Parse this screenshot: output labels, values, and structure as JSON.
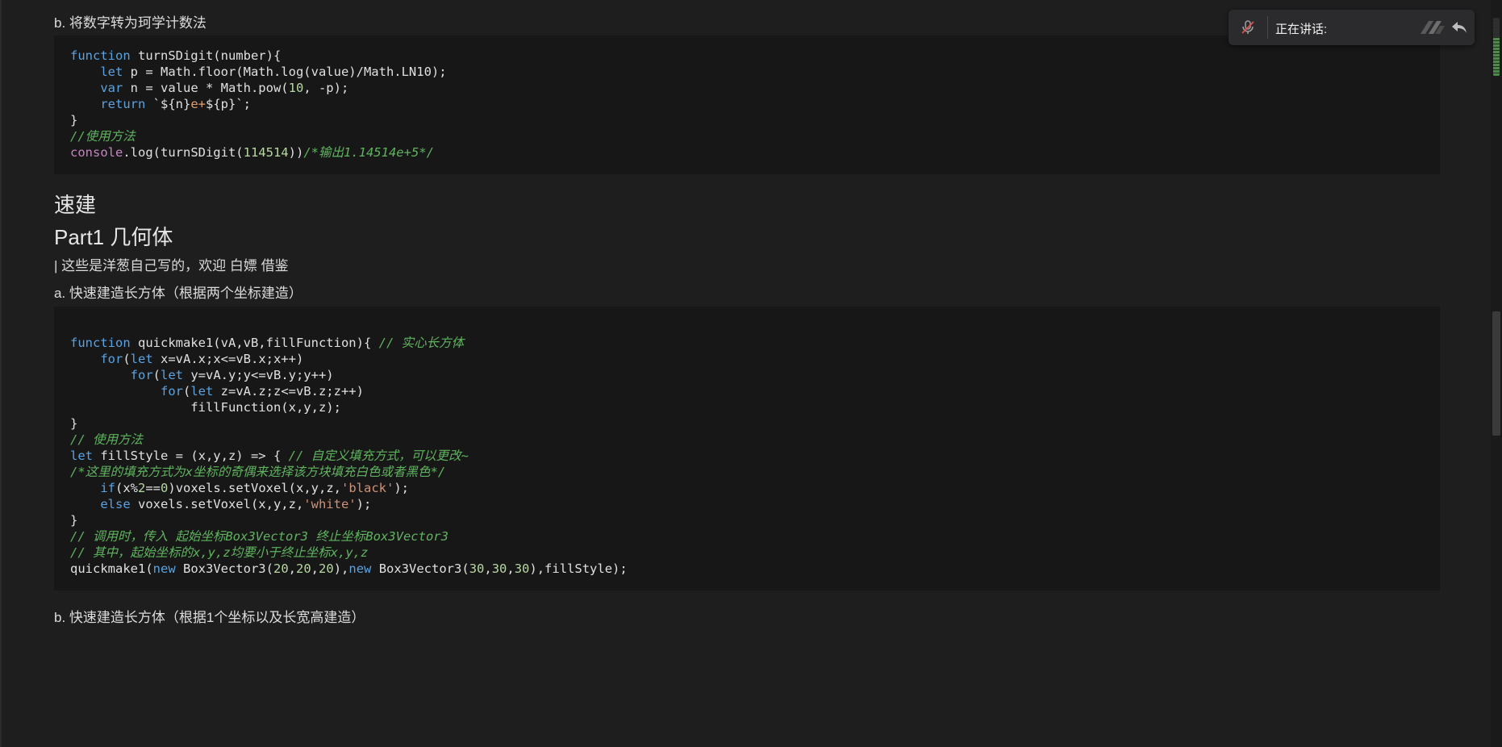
{
  "section_b_digit": {
    "heading": "b. 将数字转为珂学计数法",
    "code": [
      [
        [
          "kw",
          "function"
        ],
        [
          "",
          " turnSDigit(number){"
        ]
      ],
      [
        [
          "",
          "    "
        ],
        [
          "kw",
          "let"
        ],
        [
          "",
          " p = Math.floor(Math.log(value)/Math.LN10);"
        ]
      ],
      [
        [
          "",
          "    "
        ],
        [
          "kw",
          "var"
        ],
        [
          "",
          " n = value * Math.pow("
        ],
        [
          "num",
          "10"
        ],
        [
          "",
          ", -p);"
        ]
      ],
      [
        [
          "",
          "    "
        ],
        [
          "kw",
          "return"
        ],
        [
          "",
          " `${n}"
        ],
        [
          "tpl",
          "e+"
        ],
        [
          "",
          "${p}`;"
        ]
      ],
      [
        [
          "",
          "}"
        ]
      ],
      [
        [
          "cm",
          "//使用方法"
        ]
      ],
      [
        [
          "obj",
          "console"
        ],
        [
          "",
          ".log(turnSDigit("
        ],
        [
          "num",
          "114514"
        ],
        [
          "",
          "))"
        ],
        [
          "cm",
          "/*输出1.14514e+5*/"
        ]
      ]
    ]
  },
  "title_sujian": "速建",
  "title_part1": "Part1 几何体",
  "quote": "| 这些是洋葱自己写的，欢迎 白嫖 借鉴",
  "section_a": {
    "heading": "a. 快速建造长方体（根据两个坐标建造）",
    "code": [
      [
        [
          "kw",
          "function"
        ],
        [
          "",
          " quickmake1(vA,vB,fillFunction){ "
        ],
        [
          "cm",
          "// 实心长方体"
        ]
      ],
      [
        [
          "",
          "    "
        ],
        [
          "kw",
          "for"
        ],
        [
          "",
          "("
        ],
        [
          "kw",
          "let"
        ],
        [
          "",
          " x=vA.x;x<=vB.x;x++)"
        ]
      ],
      [
        [
          "",
          "        "
        ],
        [
          "kw",
          "for"
        ],
        [
          "",
          "("
        ],
        [
          "kw",
          "let"
        ],
        [
          "",
          " y=vA.y;y<=vB.y;y++)"
        ]
      ],
      [
        [
          "",
          "            "
        ],
        [
          "kw",
          "for"
        ],
        [
          "",
          "("
        ],
        [
          "kw",
          "let"
        ],
        [
          "",
          " z=vA.z;z<=vB.z;z++)"
        ]
      ],
      [
        [
          "",
          "                fillFunction(x,y,z);"
        ]
      ],
      [
        [
          "",
          "}"
        ]
      ],
      [
        [
          "cm",
          "// 使用方法"
        ]
      ],
      [
        [
          "kw",
          "let"
        ],
        [
          "",
          " fillStyle = (x,y,z) => { "
        ],
        [
          "cm",
          "// 自定义填充方式，可以更改~"
        ]
      ],
      [
        [
          "cm",
          "/*这里的填充方式为x坐标的奇偶来选择该方块填充白色或者黑色*/"
        ]
      ],
      [
        [
          "",
          "    "
        ],
        [
          "kw",
          "if"
        ],
        [
          "",
          "(x%"
        ],
        [
          "num",
          "2"
        ],
        [
          "",
          "=="
        ],
        [
          "num",
          "0"
        ],
        [
          "",
          ")voxels.setVoxel(x,y,z,"
        ],
        [
          "str",
          "'black'"
        ],
        [
          "",
          ");"
        ]
      ],
      [
        [
          "",
          "    "
        ],
        [
          "kw",
          "else"
        ],
        [
          "",
          " voxels.setVoxel(x,y,z,"
        ],
        [
          "str",
          "'white'"
        ],
        [
          "",
          ");"
        ]
      ],
      [
        [
          "",
          "}"
        ]
      ],
      [
        [
          "cm",
          "// 调用时，传入 起始坐标Box3Vector3 终止坐标Box3Vector3"
        ]
      ],
      [
        [
          "cm",
          "// 其中，起始坐标的x,y,z均要小于终止坐标x,y,z"
        ]
      ],
      [
        [
          "",
          "quickmake1("
        ],
        [
          "kw",
          "new"
        ],
        [
          "",
          " Box3Vector3("
        ],
        [
          "num",
          "20"
        ],
        [
          "",
          ","
        ],
        [
          "num",
          "20"
        ],
        [
          "",
          ","
        ],
        [
          "num",
          "20"
        ],
        [
          "",
          "),"
        ],
        [
          "kw",
          "new"
        ],
        [
          "",
          " Box3Vector3("
        ],
        [
          "num",
          "30"
        ],
        [
          "",
          ","
        ],
        [
          "num",
          "30"
        ],
        [
          "",
          ","
        ],
        [
          "num",
          "30"
        ],
        [
          "",
          "),fillStyle);"
        ]
      ]
    ]
  },
  "section_b_cuboid": {
    "heading": "b. 快速建造长方体（根据1个坐标以及长宽高建造）"
  },
  "voice_widget": {
    "label": "正在讲话:",
    "mic_icon": "mic-muted-icon",
    "back_icon": "reply-arrow-icon"
  },
  "colors": {
    "keyword": "#5aa2e0",
    "comment": "#5fb35f",
    "number": "#b8d7a3",
    "string": "#ce9178",
    "code_bg": "#171717",
    "page_bg": "#1e1e1e"
  }
}
